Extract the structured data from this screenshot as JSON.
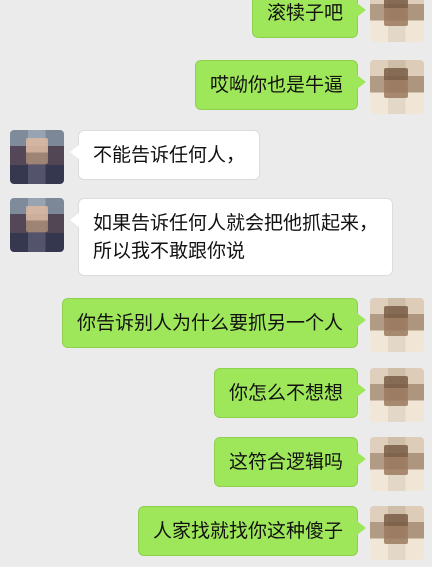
{
  "messages": [
    {
      "side": "right",
      "lines": [
        "滚犊子吧"
      ]
    },
    {
      "side": "right",
      "lines": [
        "哎呦你也是牛逼"
      ]
    },
    {
      "side": "left",
      "lines": [
        "不能告诉任何人，"
      ]
    },
    {
      "side": "left",
      "lines": [
        "如果告诉任何人就会把他抓起来，",
        "所以我不敢跟你说"
      ]
    },
    {
      "side": "right",
      "lines": [
        "你告诉别人为什么要抓另一个人"
      ]
    },
    {
      "side": "right",
      "lines": [
        "你怎么不想想"
      ]
    },
    {
      "side": "right",
      "lines": [
        "这符合逻辑吗"
      ]
    },
    {
      "side": "right",
      "lines": [
        "人家找就找你这种傻子"
      ]
    }
  ],
  "colors": {
    "background": "#ebebeb",
    "right_bubble": "#9fe75a",
    "left_bubble": "#ffffff"
  }
}
